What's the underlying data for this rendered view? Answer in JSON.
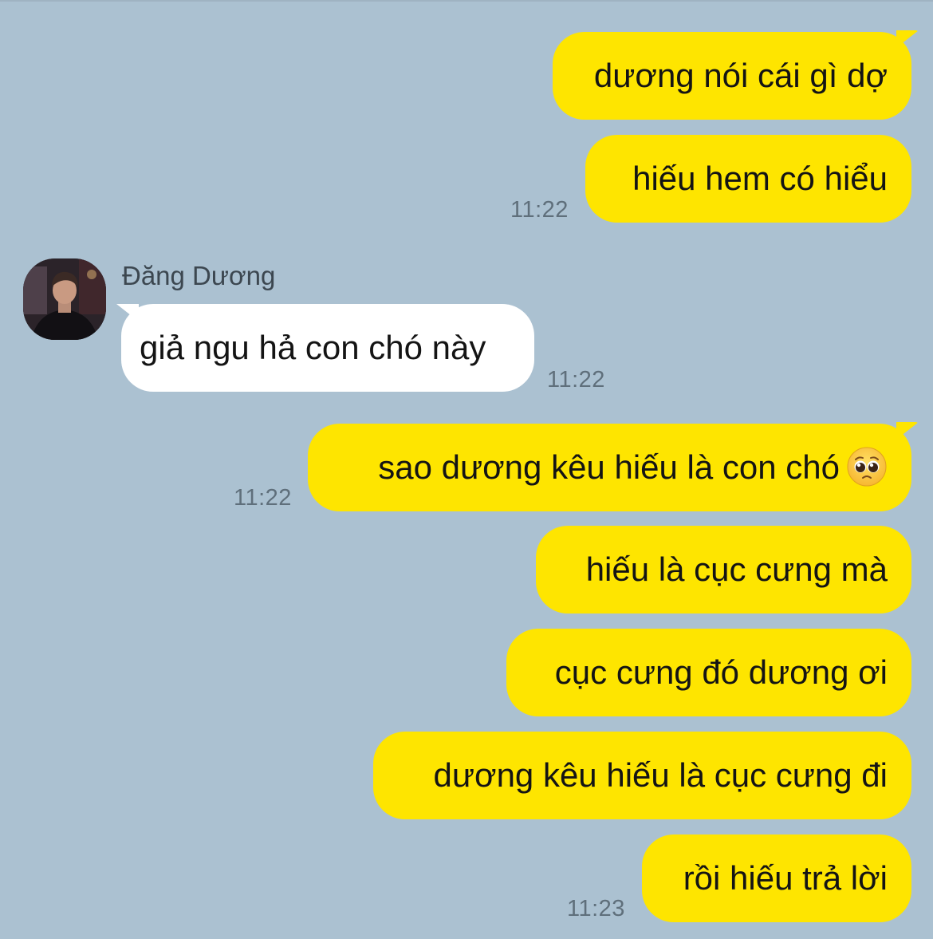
{
  "contact": {
    "name": "Đăng Dương"
  },
  "messages": [
    {
      "from": "me",
      "text": "dương nói cái gì dợ"
    },
    {
      "from": "me",
      "text": "hiếu hem có hiểu",
      "time": "11:22"
    },
    {
      "from": "them",
      "text": "giả ngu hả con chó này",
      "time": "11:22"
    },
    {
      "from": "me",
      "text": "sao dương kêu hiếu là con chó",
      "emoji": "pleading-face",
      "time": "11:22"
    },
    {
      "from": "me",
      "text": "hiếu là cục cưng mà"
    },
    {
      "from": "me",
      "text": "cục cưng đó dương ơi"
    },
    {
      "from": "me",
      "text": "dương kêu hiếu là cục cưng đi"
    },
    {
      "from": "me",
      "text": "rồi hiếu trả lời",
      "time": "11:23"
    }
  ],
  "colors": {
    "background": "#abc1d1",
    "my_bubble": "#fee500",
    "their_bubble": "#ffffff",
    "timestamp": "#5f6f7b"
  }
}
